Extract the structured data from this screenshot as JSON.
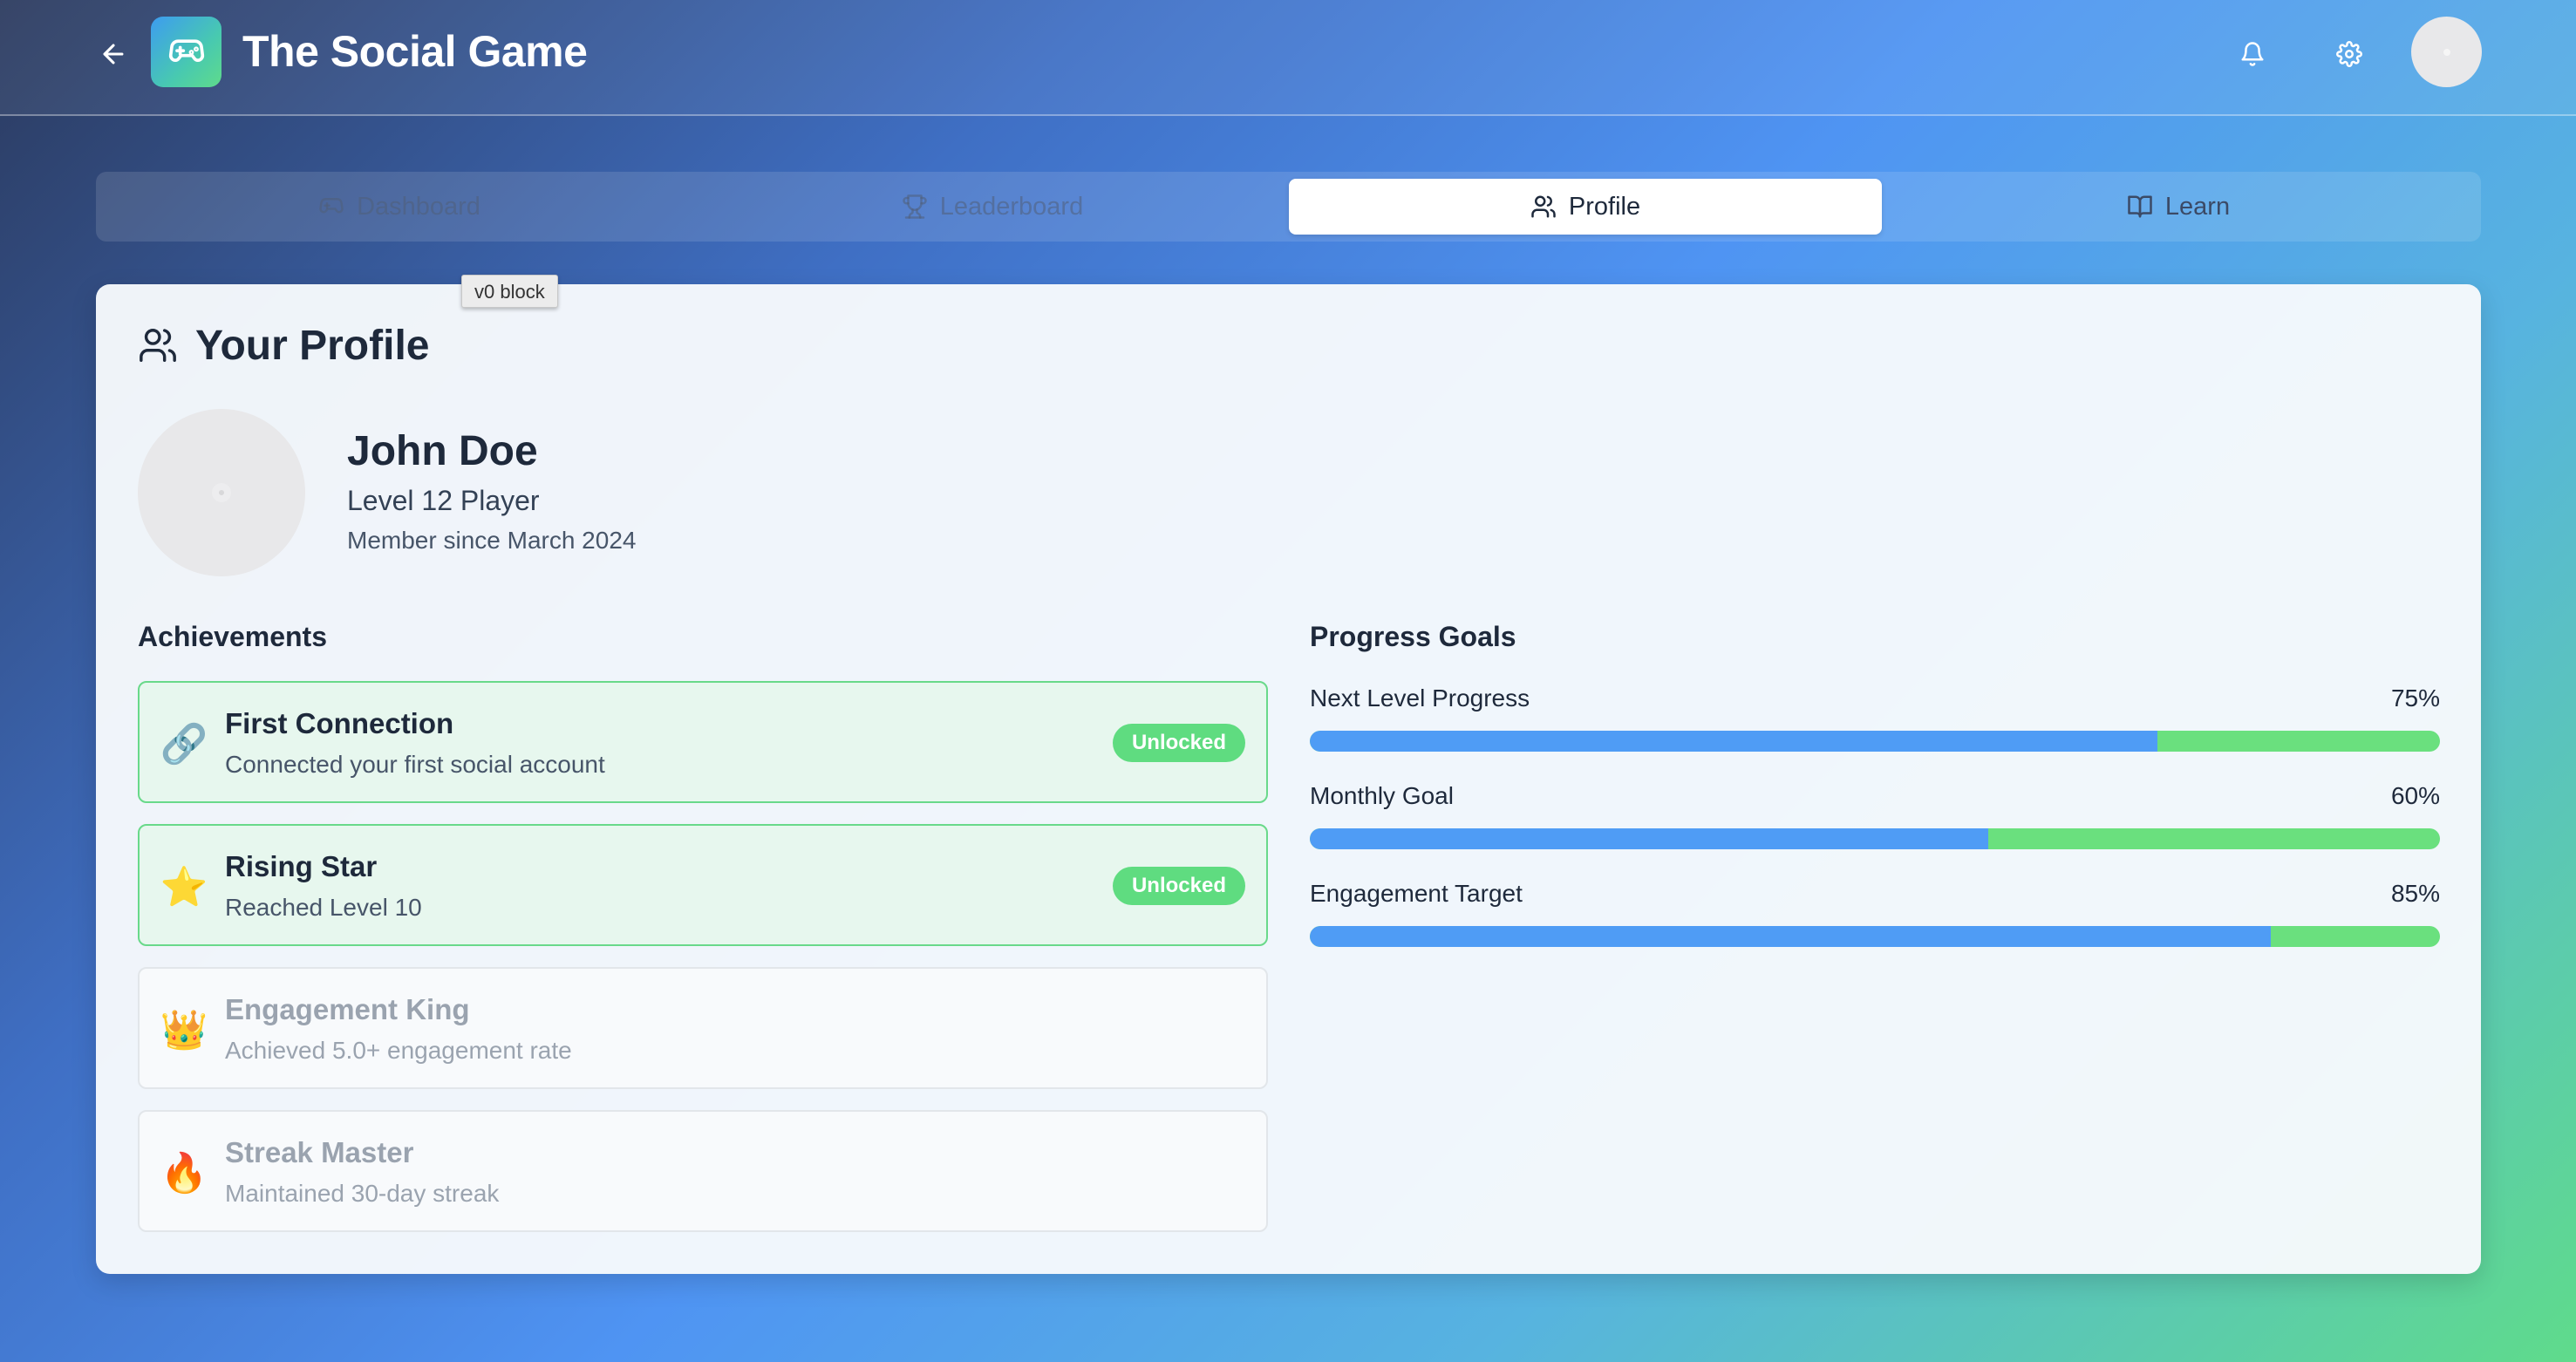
{
  "header": {
    "title": "The Social Game",
    "icons": {
      "back": "arrow-left-icon",
      "logo": "gamepad-icon",
      "notifications": "bell-icon",
      "settings": "gear-icon",
      "avatar": "avatar"
    }
  },
  "tabs": [
    {
      "label": "Dashboard",
      "icon": "gamepad-icon",
      "active": false
    },
    {
      "label": "Leaderboard",
      "icon": "trophy-icon",
      "active": false
    },
    {
      "label": "Profile",
      "icon": "users-icon",
      "active": true
    },
    {
      "label": "Learn",
      "icon": "book-icon",
      "active": false
    }
  ],
  "tooltip": "v0 block",
  "profile": {
    "section_title": "Your Profile",
    "name": "John Doe",
    "level": "Level 12 Player",
    "member_since": "Member since March 2024"
  },
  "achievements": {
    "title": "Achievements",
    "items": [
      {
        "emoji": "🔗",
        "title": "First Connection",
        "description": "Connected your first social account",
        "status": "Unlocked"
      },
      {
        "emoji": "⭐",
        "title": "Rising Star",
        "description": "Reached Level 10",
        "status": "Unlocked"
      },
      {
        "emoji": "👑",
        "title": "Engagement King",
        "description": "Achieved 5.0+ engagement rate",
        "status": ""
      },
      {
        "emoji": "🔥",
        "title": "Streak Master",
        "description": "Maintained 30-day streak",
        "status": ""
      }
    ]
  },
  "progress": {
    "title": "Progress Goals",
    "goals": [
      {
        "label": "Next Level Progress",
        "percent_label": "75%",
        "value": 75
      },
      {
        "label": "Monthly Goal",
        "percent_label": "60%",
        "value": 60
      },
      {
        "label": "Engagement Target",
        "percent_label": "85%",
        "value": 85
      }
    ]
  },
  "colors": {
    "progress_fill": "#4f9cf5",
    "progress_track": "#6ae07e",
    "badge": "#5fdc80",
    "unlocked_border": "#69d98a"
  }
}
